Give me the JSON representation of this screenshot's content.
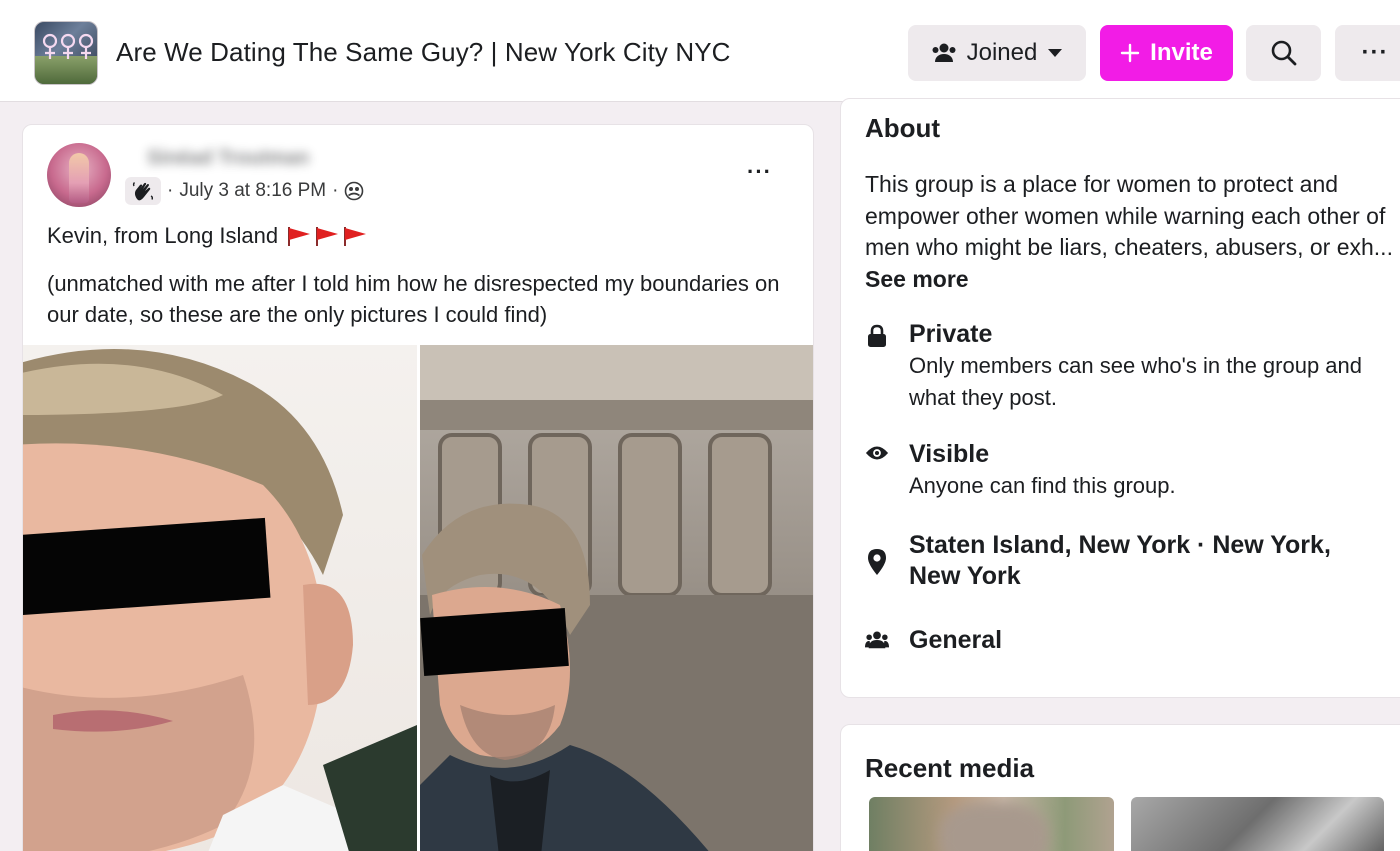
{
  "header": {
    "group_title": "Are We Dating The Same Guy? | New York City NYC",
    "joined_label": "Joined",
    "invite_label": "Invite",
    "more_label": "···"
  },
  "post": {
    "author_name": "Sinéad Troutman",
    "timestamp": "July 3 at 8:16 PM",
    "separator": "·",
    "line1": "Kevin, from Long Island",
    "line2": "(unmatched with me after I told him how he disrespected my boundaries on our date, so these are the only pictures I could find)",
    "menu_label": "···"
  },
  "about": {
    "title": "About",
    "description": "This group is a place for women to protect and empower other women while warning each other of men who might be liars, cheaters, abusers, or exh...",
    "see_more": "See more",
    "items": [
      {
        "icon": "lock-icon",
        "title": "Private",
        "subtitle": "Only members can see who's in the group and what they post."
      },
      {
        "icon": "eye-icon",
        "title": "Visible",
        "subtitle": "Anyone can find this group."
      },
      {
        "icon": "location-pin-icon",
        "title": "Staten Island, New York · New York, New York",
        "subtitle": ""
      },
      {
        "icon": "people-icon",
        "title": "General",
        "subtitle": ""
      }
    ]
  },
  "recent_media": {
    "title": "Recent media"
  },
  "colors": {
    "invite_accent": "#f21ce6",
    "page_background": "#f3eef2",
    "flag_red": "#e02020"
  }
}
